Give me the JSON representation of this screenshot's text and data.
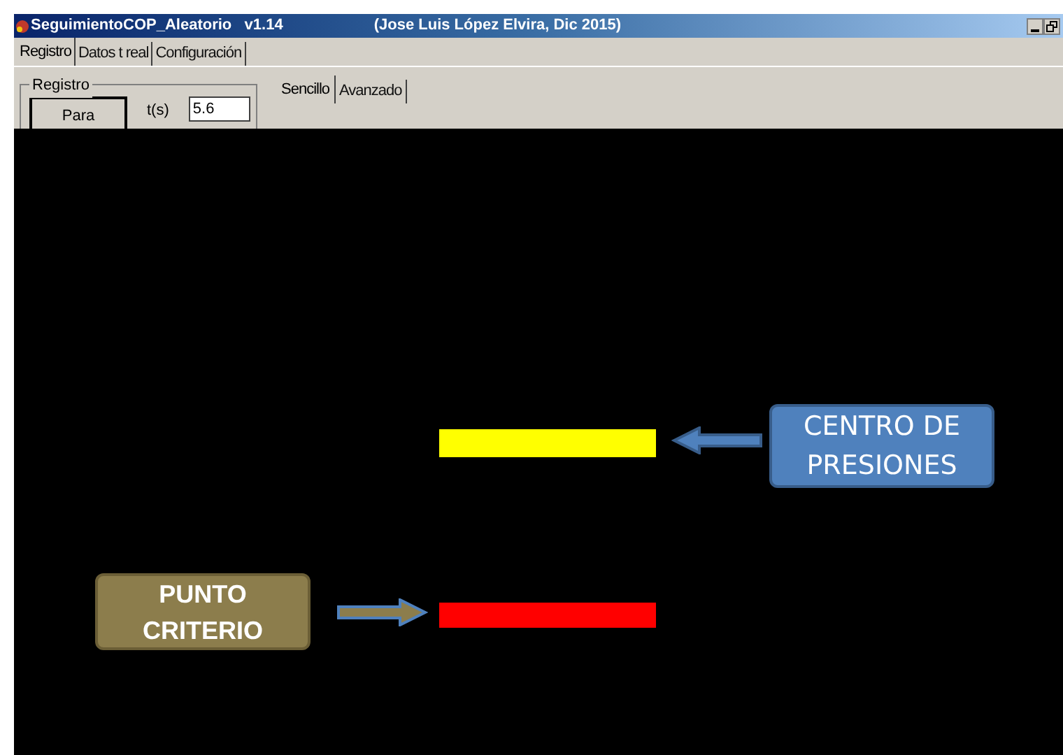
{
  "window": {
    "title": "SeguimientoCOP_Aleatorio   v1.14",
    "author": "(Jose Luis López Elvira, Dic 2015)"
  },
  "tabs": [
    {
      "label": "Registro",
      "selected": true
    },
    {
      "label": "Datos t real",
      "selected": false
    },
    {
      "label": "Configuración",
      "selected": false
    }
  ],
  "group": {
    "title": "Registro",
    "button": "Para",
    "field_label": "t(s)",
    "field_value": "5.6"
  },
  "subtabs": [
    {
      "label": "Sencillo",
      "selected": true
    },
    {
      "label": "Avanzado",
      "selected": false
    }
  ],
  "canvas": {
    "bars": [
      {
        "kind": "cop",
        "color": "#ffff00"
      },
      {
        "kind": "criterion",
        "color": "#ff0000"
      }
    ],
    "callouts": [
      {
        "kind": "cop",
        "lines": [
          "CENTRO DE",
          "PRESIONES"
        ]
      },
      {
        "kind": "criterion",
        "lines": [
          "PUNTO",
          "CRITERIO"
        ]
      }
    ]
  }
}
